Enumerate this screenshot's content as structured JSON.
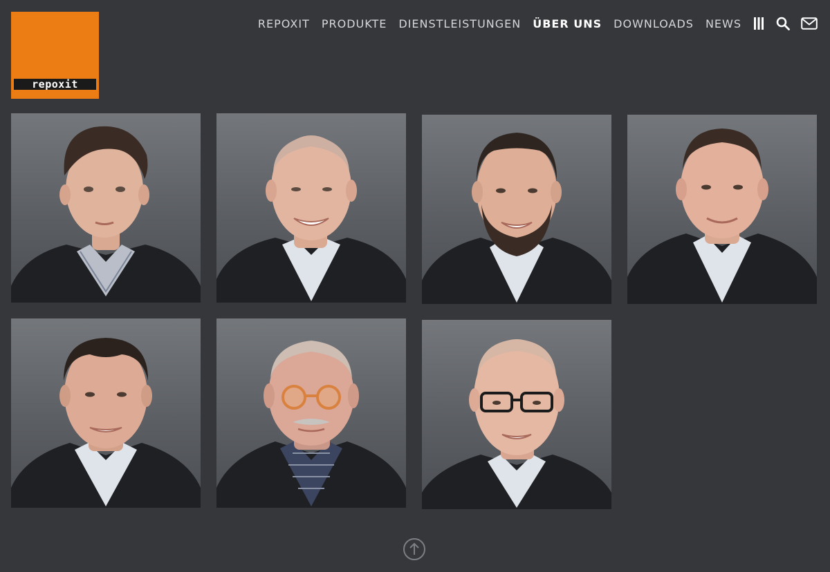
{
  "brand": {
    "logo_text": "repoxit",
    "accent_color": "#ec7d14"
  },
  "nav": {
    "items": [
      {
        "label": "REPOXIT",
        "active": false
      },
      {
        "label": "PRODUKTE",
        "active": false
      },
      {
        "label": "DIENSTLEISTUNGEN",
        "active": false
      },
      {
        "label": "ÜBER UNS",
        "active": true
      },
      {
        "label": "DOWNLOADS",
        "active": false
      },
      {
        "label": "NEWS",
        "active": false
      }
    ],
    "icons": [
      "menu-icon",
      "search-icon",
      "mail-icon"
    ]
  },
  "team": [
    {
      "portrait": "young man, dark hair, striped shirt"
    },
    {
      "portrait": "older bald man, smiling"
    },
    {
      "portrait": "man with beard, receding hairline"
    },
    {
      "portrait": "man with short hair, white shirt"
    },
    {
      "portrait": "man with short hair, smiling"
    },
    {
      "portrait": "older man, orange glasses, moustache"
    },
    {
      "portrait": "bald man, dark glasses"
    }
  ],
  "footer": {
    "scroll_top_icon": "arrow-up-circle-icon"
  },
  "colors": {
    "background": "#35373b",
    "nav_text": "#d6d7da",
    "nav_active": "#ffffff",
    "photo_bg": "#64676b",
    "jacket": "#1f2023"
  }
}
